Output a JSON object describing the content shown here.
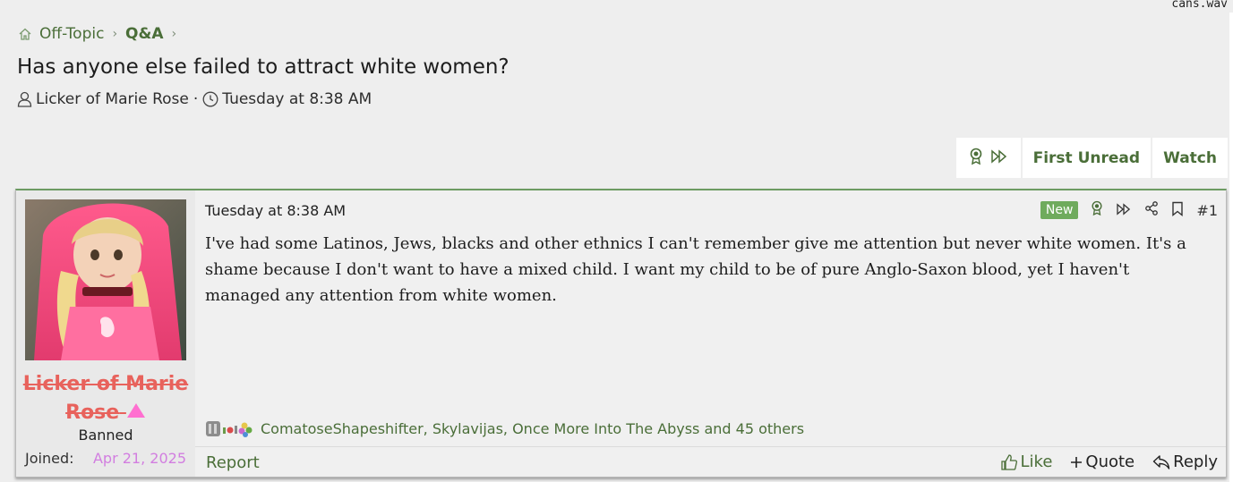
{
  "topbar": {
    "corner_text": "cans.wav"
  },
  "breadcrumb": {
    "items": [
      {
        "label": "Off-Topic"
      },
      {
        "label": "Q&A"
      }
    ]
  },
  "thread": {
    "title": "Has anyone else failed to attract white women?",
    "author": "Licker of Marie Rose",
    "date": "Tuesday at 8:38 AM",
    "separator": "·"
  },
  "toolbar": {
    "first_unread_label": "First Unread",
    "watch_label": "Watch"
  },
  "post": {
    "user": {
      "name": "Licker of Marie Rose",
      "title": "Banned",
      "joined_label": "Joined:",
      "joined_value": "Apr 21, 2025"
    },
    "date": "Tuesday at 8:38 AM",
    "new_badge": "New",
    "number": "#1",
    "body": "I've had some Latinos, Jews, blacks and other ethnics I can't remember give me attention but never white women. It's a shame because I don't want to have a mixed child. I want my child to be of pure Anglo-Saxon blood, yet I haven't managed any attention from white women.",
    "reactions_text": "ComatoseShapeshifter, Skylavijas, Once More Into The Abyss and 45 others",
    "report_label": "Report",
    "like_label": "Like",
    "quote_label": "Quote",
    "reply_label": "Reply"
  },
  "colors": {
    "link_green": "#4a6e38",
    "username_red": "#e8625c",
    "joined_pink": "#d27ee0",
    "badge_green": "#6fab5d",
    "post_border_top": "#6c9b62"
  }
}
